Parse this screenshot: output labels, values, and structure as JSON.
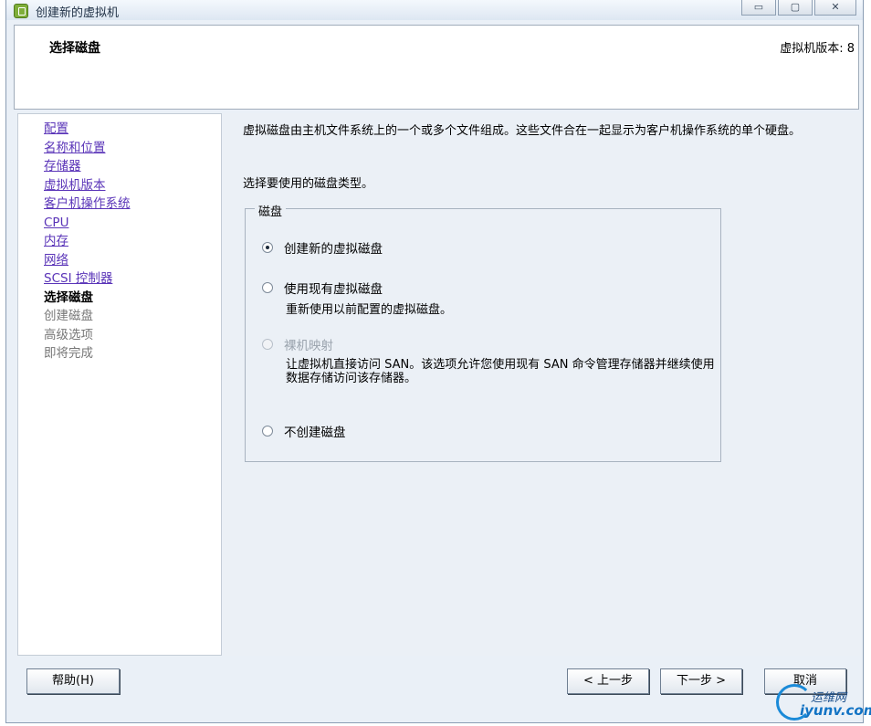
{
  "window": {
    "title": "创建新的虚拟机",
    "controls": {
      "minimize": "▭",
      "maximize": "▢",
      "close": "✕"
    }
  },
  "header": {
    "title": "选择磁盘",
    "version": "虚拟机版本: 8"
  },
  "nav": {
    "items": [
      {
        "label": "配置",
        "state": "done"
      },
      {
        "label": "名称和位置",
        "state": "done"
      },
      {
        "label": "存储器",
        "state": "done"
      },
      {
        "label": "虚拟机版本",
        "state": "done"
      },
      {
        "label": "客户机操作系统",
        "state": "done"
      },
      {
        "label": "CPU",
        "state": "done"
      },
      {
        "label": "内存",
        "state": "done"
      },
      {
        "label": "网络",
        "state": "done"
      },
      {
        "label": "SCSI 控制器",
        "state": "done"
      },
      {
        "label": "选择磁盘",
        "state": "current"
      },
      {
        "label": "创建磁盘",
        "state": "future"
      },
      {
        "label": "高级选项",
        "state": "future"
      },
      {
        "label": "即将完成",
        "state": "future"
      }
    ]
  },
  "content": {
    "description": "虚拟磁盘由主机文件系统上的一个或多个文件组成。这些文件合在一起显示为客户机操作系统的单个硬盘。",
    "prompt": "选择要使用的磁盘类型。",
    "group_label": "磁盘",
    "options": [
      {
        "label": "创建新的虚拟磁盘",
        "selected": true,
        "enabled": true,
        "description": ""
      },
      {
        "label": "使用现有虚拟磁盘",
        "selected": false,
        "enabled": true,
        "description": "重新使用以前配置的虚拟磁盘。"
      },
      {
        "label": "裸机映射",
        "selected": false,
        "enabled": false,
        "description": "让虚拟机直接访问 SAN。该选项允许您使用现有 SAN 命令管理存储器并继续使用数据存储访问该存储器。"
      },
      {
        "label": "不创建磁盘",
        "selected": false,
        "enabled": true,
        "description": ""
      }
    ]
  },
  "buttons": {
    "help": "帮助(H)",
    "back": "< 上一步",
    "next": "下一步 >",
    "cancel": "取消"
  },
  "watermark": {
    "cn": "运维网",
    "en": "iyunv.com"
  },
  "colors": {
    "link": "#5a34b8",
    "panel_bg": "#ebf0f6",
    "header_bg": "#ffffff"
  }
}
